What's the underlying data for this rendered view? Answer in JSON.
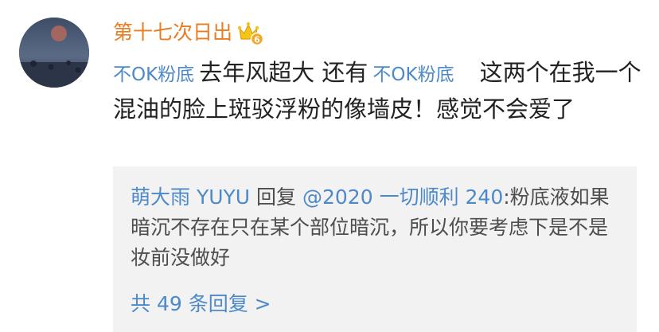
{
  "comment": {
    "username": "第十七次日出",
    "badge_icon": "vip-crown-badge-icon",
    "text": {
      "mention_1": "不OK粉底",
      "segment_1": "去年风超大 还有",
      "mention_2": "不OK粉底",
      "segment_2": "这两个在我一个混油的脸上斑驳浮粉的像墙皮！感觉不会爱了"
    }
  },
  "reply": {
    "user": "萌大雨 YUYU",
    "action": " 回复 ",
    "target": "@2020 一切顺利 240",
    "separator": ":",
    "text": "粉底液如果暗沉不存在只在某个部位暗沉，所以你要考虑下是不是妆前没做好",
    "more_label": "共 49 条回复 >"
  },
  "colors": {
    "username": "#ea7c21",
    "link": "#4d89c8",
    "text": "#222222",
    "reply_bg": "#f2f2f2"
  }
}
